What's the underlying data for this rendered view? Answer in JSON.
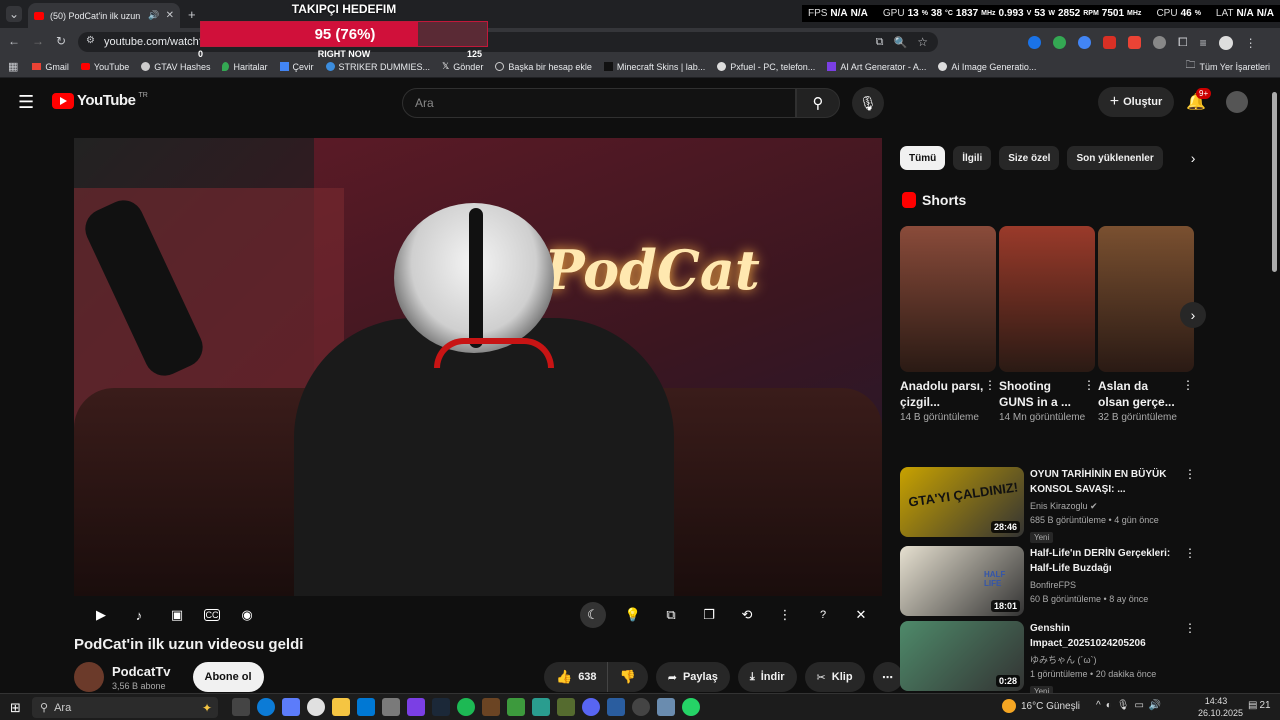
{
  "browser": {
    "tab_title": "(50) PodCat'in ilk uzun vide",
    "url": "youtube.com/watch?v",
    "bookmarks": [
      "Gmail",
      "YouTube",
      "GTAV Hashes",
      "Haritalar",
      "Çevir",
      "STRIKER DUMMIES...",
      "Gönder",
      "Başka bir hesap ekle",
      "Minecraft Skins | lab...",
      "Pxfuel - PC, telefon...",
      "AI Art Generator - A...",
      "Ai Image Generatio..."
    ],
    "all_bookmarks": "Tüm Yer İşaretleri"
  },
  "goal_overlay": {
    "title": "TAKIPÇI HEDEFIM",
    "value_text": "95 (76%)",
    "progress": 0.76,
    "min": "0",
    "max": "125",
    "subtitle": "RIGHT NOW"
  },
  "hw_monitor": {
    "fps_label": "FPS",
    "fps": "N/A",
    "fps2": "N/A",
    "gpu_label": "GPU",
    "gpu_util": "13",
    "gpu_temp": "38",
    "gpu_clock": "1837",
    "gpu_volt": "0.993",
    "gpu_power": "53",
    "gpu_fan": "2852",
    "gpu_mem": "7501",
    "cpu_label": "CPU",
    "cpu_util": "46",
    "lat_label": "LAT",
    "lat": "N/A",
    "lat2": "N/A"
  },
  "youtube": {
    "logo": "YouTube",
    "region": "TR",
    "search_placeholder": "Ara",
    "create_label": "Oluştur",
    "notif_count": "9+"
  },
  "video": {
    "title": "PodCat'in ilk uzun videosu geldi",
    "channel": "PodcatTv",
    "subscribers": "3,56 B abone",
    "subscribe_label": "Abone ol",
    "likes": "638",
    "share_label": "Paylaş",
    "download_label": "İndir",
    "clip_label": "Klip",
    "neon_text": "PodCat"
  },
  "chips": [
    "Tümü",
    "İlgili",
    "Size özel",
    "Son yüklenenler"
  ],
  "shorts_header": "Shorts",
  "shorts": [
    {
      "title": "Anadolu parsı, çizgil...",
      "views": "14 B görüntüleme",
      "color": "#8a4b3a"
    },
    {
      "title": "Shooting GUNS in a ...",
      "views": "14 Mn görüntüleme",
      "color": "#9a3a2a"
    },
    {
      "title": "Aslan da olsan gerçe...",
      "views": "32 B görüntüleme",
      "color": "#7a5030"
    }
  ],
  "recommended": [
    {
      "title": "OYUN TARİHİNİN EN BÜYÜK KONSOL SAVAŞI: ...",
      "channel": "Enis Kirazoglu",
      "meta": "685 B görüntüleme • 4 gün önce",
      "duration": "28:46",
      "badge": "Yeni",
      "thumb_text": "GTA'YI ÇALDINIZ!",
      "color": "#c8a200"
    },
    {
      "title": "Half-Life'ın DERİN Gerçekleri: Half-Life Buzdağı",
      "channel": "BonfireFPS",
      "meta": "60 B görüntüleme • 8 ay önce",
      "duration": "18:01",
      "badge": "",
      "thumb_text": "HALF LIFE",
      "color": "#e6e0d0"
    },
    {
      "title": "Genshin Impact_20251024205206",
      "channel": "ゆみちゃん (´ω`)",
      "meta": "1 görüntüleme • 20 dakika önce",
      "duration": "0:28",
      "badge": "Yeni",
      "thumb_text": "",
      "color": "#4e8a6a"
    }
  ],
  "taskbar": {
    "search_placeholder": "Ara",
    "weather": "16°C Güneşli",
    "time": "14:43",
    "date": "26.10.2025",
    "notif_count": "21"
  }
}
